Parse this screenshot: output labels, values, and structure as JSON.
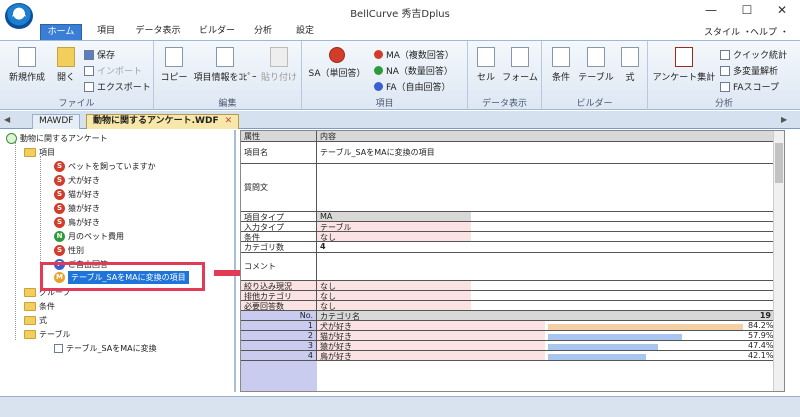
{
  "window": {
    "title": "BellCurve 秀吉Dplus",
    "minimize": "—",
    "maximize": "☐",
    "close": "✕"
  },
  "menu": {
    "tabs": [
      "ホーム",
      "項目",
      "データ表示",
      "ビルダー",
      "分析",
      "設定"
    ],
    "right": [
      "スタイル ・",
      "ヘルプ ・"
    ]
  },
  "ribbon": {
    "file": {
      "label": "ファイル",
      "new": "新規作成",
      "open": "開く",
      "save": "保存",
      "import": "インポート",
      "export": "エクスポート"
    },
    "edit": {
      "label": "編集",
      "copy": "コピー",
      "copy_info": "項目情報をｺﾋﾟｰ",
      "paste": "貼り付け"
    },
    "items": {
      "label": "項目",
      "sa": "SA（単回答）",
      "ma": "MA（複数回答）",
      "na": "NA（数量回答）",
      "fa": "FA（自由回答）"
    },
    "dataview": {
      "label": "データ表示",
      "cell": "セル",
      "form": "フォーム"
    },
    "builder": {
      "label": "ビルダー",
      "condition": "条件",
      "table": "テーブル",
      "formula": "式"
    },
    "analysis": {
      "label": "分析",
      "survey": "アンケート集計",
      "quick": "クイック統計",
      "multi": "多変量解析",
      "fa_scope": "FAスコープ"
    }
  },
  "doc_tabs": [
    "MAWDF",
    "動物に関するアンケート.WDF"
  ],
  "tree": {
    "root": "動物に関するアンケート",
    "items_folder": "項目",
    "items": [
      {
        "badge": "S",
        "color": "red",
        "label": "ペットを飼っていますか"
      },
      {
        "badge": "S",
        "color": "red",
        "label": "犬が好き"
      },
      {
        "badge": "S",
        "color": "red",
        "label": "猫が好き"
      },
      {
        "badge": "S",
        "color": "red",
        "label": "猿が好き"
      },
      {
        "badge": "S",
        "color": "red",
        "label": "鳥が好き"
      },
      {
        "badge": "N",
        "color": "green",
        "label": "月のペット費用"
      },
      {
        "badge": "S",
        "color": "red",
        "label": "性別"
      },
      {
        "badge": "F",
        "color": "blue",
        "label": "ご自由回答"
      },
      {
        "badge": "M",
        "color": "red",
        "label": "テーブル_SAをMAに変換の項目"
      }
    ],
    "group_folder": "グループ",
    "condition_folder": "条件",
    "formula_folder": "式",
    "table_folder": "テーブル",
    "table_item": "テーブル_SAをMAに変換"
  },
  "props": {
    "header": {
      "key": "属性",
      "val": "内容"
    },
    "name": {
      "key": "項目名",
      "val": "テーブル_SAをMAに変換の項目"
    },
    "question": {
      "key": "質問文",
      "val": ""
    },
    "type": {
      "key": "項目タイプ",
      "val": "MA"
    },
    "input": {
      "key": "入力タイプ",
      "val": "テーブル"
    },
    "condition": {
      "key": "条件",
      "val": "なし"
    },
    "categories": {
      "key": "カテゴリ数",
      "val": "4"
    },
    "comment": {
      "key": "コメント",
      "val": ""
    },
    "narrow": {
      "key": "絞り込み現況",
      "val": "なし"
    },
    "exclusive": {
      "key": "排他カテゴリ",
      "val": "なし"
    },
    "required": {
      "key": "必要回答数",
      "val": "なし"
    },
    "cat_header": {
      "no": "No.",
      "name": "カテゴリ名",
      "count": "19"
    },
    "cat_rows": [
      {
        "no": "1",
        "name": "犬が好き",
        "pct": "84.2%",
        "value": 0.842,
        "color": "#f4d0a4"
      },
      {
        "no": "2",
        "name": "猫が好き",
        "pct": "57.9%",
        "value": 0.579,
        "color": "#a8c6ef"
      },
      {
        "no": "3",
        "name": "猿が好き",
        "pct": "47.4%",
        "value": 0.474,
        "color": "#a8c6ef"
      },
      {
        "no": "4",
        "name": "鳥が好き",
        "pct": "42.1%",
        "value": 0.421,
        "color": "#a8c6ef"
      }
    ]
  }
}
